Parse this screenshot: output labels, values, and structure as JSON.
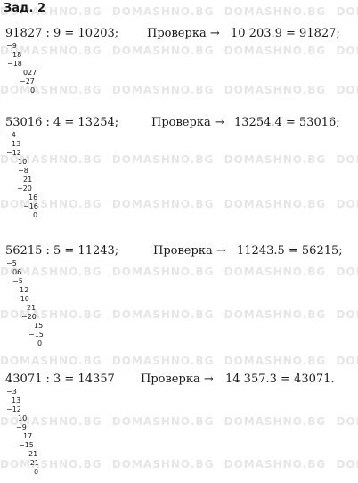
{
  "title": "Зад. 2",
  "watermark": "DOMASHNO.BG",
  "check_label": "Проверка →",
  "problems": [
    {
      "equation": "91827 : 9 = 10203;",
      "check": "10 203.9 = 91827;",
      "steps": [
        "−9",
        "18",
        "−18",
        "027",
        "−27",
        "0"
      ]
    },
    {
      "equation": "53016 : 4 = 13254;",
      "check": "13254.4 = 53016;",
      "steps": [
        "−4",
        "13",
        "−12",
        "10",
        "−8",
        "21",
        "−20",
        "16",
        "−16",
        "0"
      ]
    },
    {
      "equation": "56215 : 5 = 11243;",
      "check": "11243.5 = 56215;",
      "steps": [
        "−5",
        "06",
        "−5",
        "12",
        "−10",
        "21",
        "−20",
        "15",
        "−15",
        "0"
      ]
    },
    {
      "equation": "43071 : 3 = 14357",
      "check": "14 357.3 = 43071.",
      "steps": [
        "−3",
        "13",
        "−12",
        "10",
        "−9",
        "17",
        "−15",
        "21",
        "−21",
        "0"
      ]
    }
  ]
}
